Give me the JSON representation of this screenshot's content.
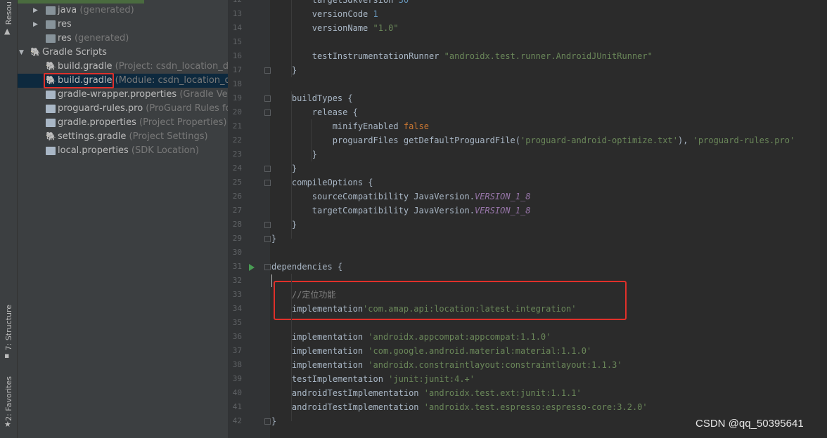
{
  "toolstrip": {
    "resource_tab": "Resou",
    "structure_tab": "7: Structure",
    "favorites_tab": "2: Favorites"
  },
  "tree": {
    "rows": [
      {
        "name": "java",
        "note": "(generated)",
        "icon": "folder-icon",
        "arrow": "▶",
        "indent": 1
      },
      {
        "name": "res",
        "note": "",
        "icon": "folder-icon",
        "arrow": "▶",
        "indent": 1
      },
      {
        "name": "res",
        "note": "(generated)",
        "icon": "folder-icon",
        "arrow": "",
        "indent": 1
      },
      {
        "name": "Gradle Scripts",
        "note": "",
        "icon": "gradle-icon",
        "arrow": "▼",
        "indent": 0
      },
      {
        "name": "build.gradle",
        "note": "(Project: csdn_location_demo",
        "icon": "gradle-icon",
        "arrow": "",
        "indent": 2
      },
      {
        "name": "build.gradle",
        "note": "(Module: csdn_location_demo",
        "icon": "gradle-icon",
        "arrow": "",
        "indent": 2,
        "selected": true
      },
      {
        "name": "gradle-wrapper.properties",
        "note": "(Gradle Versio",
        "icon": "properties-icon",
        "arrow": "",
        "indent": 2
      },
      {
        "name": "proguard-rules.pro",
        "note": "(ProGuard Rules for c",
        "icon": "file-icon",
        "arrow": "",
        "indent": 2
      },
      {
        "name": "gradle.properties",
        "note": "(Project Properties)",
        "icon": "properties-icon",
        "arrow": "",
        "indent": 2
      },
      {
        "name": "settings.gradle",
        "note": "(Project Settings)",
        "icon": "gradle-icon",
        "arrow": "",
        "indent": 2
      },
      {
        "name": "local.properties",
        "note": "(SDK Location)",
        "icon": "properties-icon",
        "arrow": "",
        "indent": 2
      }
    ]
  },
  "editor": {
    "line_numbers": [
      "12",
      "13",
      "14",
      "15",
      "16",
      "17",
      "18",
      "19",
      "20",
      "21",
      "22",
      "23",
      "24",
      "25",
      "26",
      "27",
      "28",
      "29",
      "30",
      "31",
      "32",
      "33",
      "34",
      "35",
      "36",
      "37",
      "38",
      "39",
      "40",
      "41",
      "42"
    ],
    "lines": [
      [
        {
          "t": "        targetSdkVersion ",
          "c": ""
        },
        {
          "t": "30",
          "c": "n"
        }
      ],
      [
        {
          "t": "        versionCode ",
          "c": ""
        },
        {
          "t": "1",
          "c": "n"
        }
      ],
      [
        {
          "t": "        versionName ",
          "c": ""
        },
        {
          "t": "\"1.0\"",
          "c": "s"
        }
      ],
      [],
      [
        {
          "t": "        testInstrumentationRunner ",
          "c": ""
        },
        {
          "t": "\"androidx.test.runner.AndroidJUnitRunner\"",
          "c": "s"
        }
      ],
      [
        {
          "t": "    }",
          "c": ""
        }
      ],
      [],
      [
        {
          "t": "    buildTypes {",
          "c": ""
        }
      ],
      [
        {
          "t": "        release {",
          "c": ""
        }
      ],
      [
        {
          "t": "            minifyEnabled ",
          "c": ""
        },
        {
          "t": "false",
          "c": "k"
        }
      ],
      [
        {
          "t": "            proguardFiles getDefaultProguardFile(",
          "c": ""
        },
        {
          "t": "'proguard-android-optimize.txt'",
          "c": "s"
        },
        {
          "t": "), ",
          "c": ""
        },
        {
          "t": "'proguard-rules.pro'",
          "c": "s"
        }
      ],
      [
        {
          "t": "        }",
          "c": ""
        }
      ],
      [
        {
          "t": "    }",
          "c": ""
        }
      ],
      [
        {
          "t": "    compileOptions {",
          "c": ""
        }
      ],
      [
        {
          "t": "        sourceCompatibility JavaVersion.",
          "c": ""
        },
        {
          "t": "VERSION_1_8",
          "c": "i"
        }
      ],
      [
        {
          "t": "        targetCompatibility JavaVersion.",
          "c": ""
        },
        {
          "t": "VERSION_1_8",
          "c": "i"
        }
      ],
      [
        {
          "t": "    }",
          "c": ""
        }
      ],
      [
        {
          "t": "}",
          "c": ""
        }
      ],
      [],
      [
        {
          "t": "dependencies {",
          "c": ""
        }
      ],
      [],
      [
        {
          "t": "    //定位功能",
          "c": "c"
        }
      ],
      [
        {
          "t": "    implementation",
          "c": ""
        },
        {
          "t": "'com.amap.api:location:latest.integration'",
          "c": "s"
        }
      ],
      [],
      [
        {
          "t": "    implementation ",
          "c": ""
        },
        {
          "t": "'androidx.appcompat:appcompat:1.1.0'",
          "c": "s"
        }
      ],
      [
        {
          "t": "    implementation ",
          "c": ""
        },
        {
          "t": "'com.google.android.material:material:1.1.0'",
          "c": "s"
        }
      ],
      [
        {
          "t": "    implementation ",
          "c": ""
        },
        {
          "t": "'androidx.constraintlayout:constraintlayout:1.1.3'",
          "c": "s"
        }
      ],
      [
        {
          "t": "    testImplementation ",
          "c": ""
        },
        {
          "t": "'junit:junit:4.+'",
          "c": "s"
        }
      ],
      [
        {
          "t": "    androidTestImplementation ",
          "c": ""
        },
        {
          "t": "'androidx.test.ext:junit:1.1.1'",
          "c": "s"
        }
      ],
      [
        {
          "t": "    androidTestImplementation ",
          "c": ""
        },
        {
          "t": "'androidx.test.espresso:espresso-core:3.2.0'",
          "c": "s"
        }
      ],
      [
        {
          "t": "}",
          "c": ""
        }
      ]
    ]
  },
  "watermark": "CSDN @qq_50395641"
}
